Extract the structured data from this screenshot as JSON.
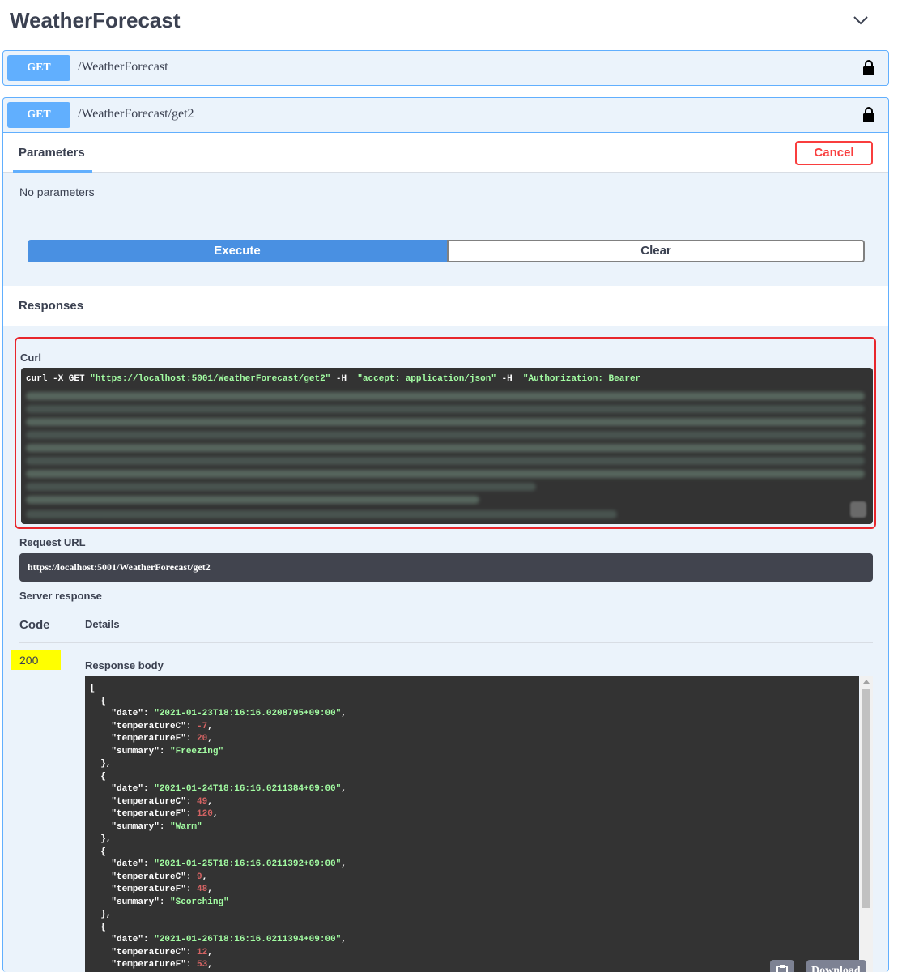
{
  "section": {
    "title": "WeatherForecast"
  },
  "ops": [
    {
      "method": "GET",
      "path": "/WeatherForecast"
    },
    {
      "method": "GET",
      "path": "/WeatherForecast/get2"
    }
  ],
  "params": {
    "tab_label": "Parameters",
    "cancel_label": "Cancel",
    "empty_text": "No parameters",
    "execute_label": "Execute",
    "clear_label": "Clear"
  },
  "responses": {
    "title": "Responses",
    "curl_label": "Curl",
    "curl_cmd": "curl -X GET ",
    "curl_url": "\"https://localhost:5001/WeatherForecast/get2\"",
    "curl_h1_flag": " -H ",
    "curl_h1": " \"accept: application/json\"",
    "curl_h2_flag": " -H ",
    "curl_h2": " \"Authorization: Bearer",
    "request_url_label": "Request URL",
    "request_url": "https://localhost:5001/WeatherForecast/get2",
    "server_response_label": "Server response",
    "col_code": "Code",
    "col_details": "Details",
    "status_code": "200",
    "response_body_label": "Response body",
    "download_label": "Download"
  },
  "body": {
    "items": [
      {
        "date": "\"2021-01-23T18:16:16.0208795+09:00\"",
        "temperatureC": "-7",
        "temperatureF": "20",
        "summary": "\"Freezing\""
      },
      {
        "date": "\"2021-01-24T18:16:16.0211384+09:00\"",
        "temperatureC": "49",
        "temperatureF": "120",
        "summary": "\"Warm\""
      },
      {
        "date": "\"2021-01-25T18:16:16.0211392+09:00\"",
        "temperatureC": "9",
        "temperatureF": "48",
        "summary": "\"Scorching\""
      },
      {
        "date": "\"2021-01-26T18:16:16.0211394+09:00\"",
        "temperatureC": "12",
        "temperatureF": "53"
      }
    ],
    "key_date": "\"date\"",
    "key_tc": "\"temperatureC\"",
    "key_tf": "\"temperatureF\"",
    "key_summary": "\"summary\""
  },
  "colors": {
    "get": "#61affe",
    "execute": "#4990e2",
    "cancel": "#f93e3e",
    "code_bg": "#333333",
    "highlight": "#ffff00"
  },
  "icons": {
    "collapse": "chevron-down-icon",
    "lock": "lock-icon",
    "copy": "copy-icon"
  }
}
